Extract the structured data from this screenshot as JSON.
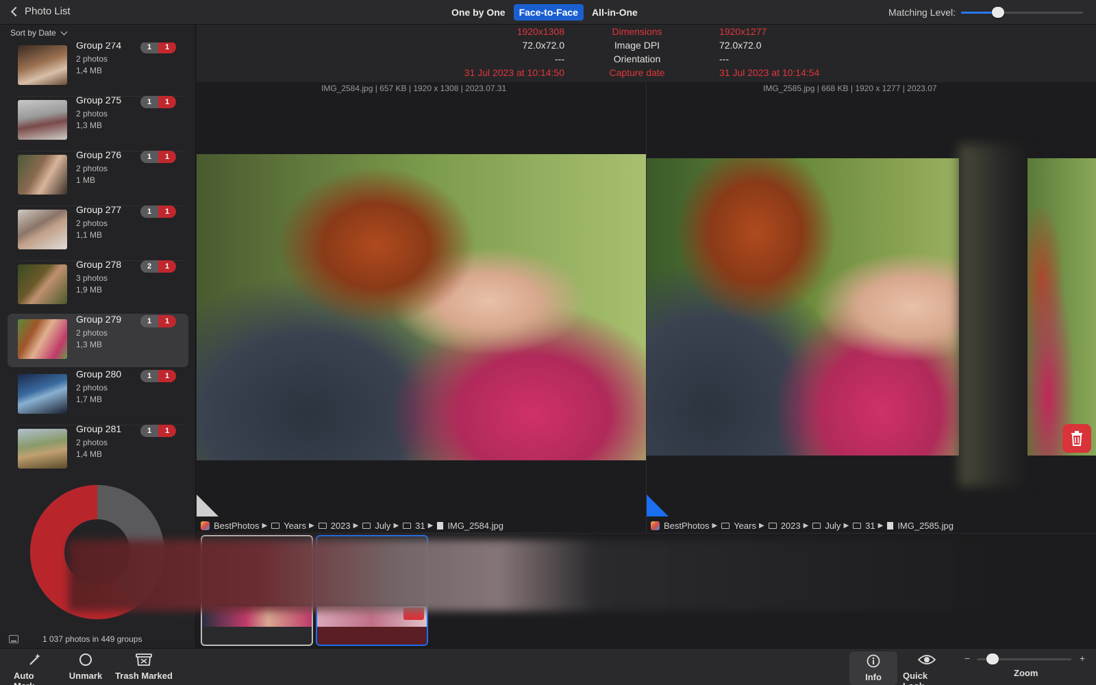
{
  "header": {
    "back_label": "Photo List",
    "modes": [
      {
        "label": "One by One",
        "active": false
      },
      {
        "label": "Face-to-Face",
        "active": true
      },
      {
        "label": "All-in-One",
        "active": false
      }
    ],
    "matching_label": "Matching Level:",
    "matching_level": 0.28
  },
  "sidebar": {
    "sort_label": "Sort by Date",
    "groups": [
      {
        "name": "Group 274",
        "photos": "2 photos",
        "size": "1,4 MB",
        "keep": "1",
        "marked": "1",
        "selected": false
      },
      {
        "name": "Group 275",
        "photos": "2 photos",
        "size": "1,3 MB",
        "keep": "1",
        "marked": "1",
        "selected": false
      },
      {
        "name": "Group 276",
        "photos": "2 photos",
        "size": "1 MB",
        "keep": "1",
        "marked": "1",
        "selected": false
      },
      {
        "name": "Group 277",
        "photos": "2 photos",
        "size": "1,1 MB",
        "keep": "1",
        "marked": "1",
        "selected": false
      },
      {
        "name": "Group 278",
        "photos": "3 photos",
        "size": "1,9 MB",
        "keep": "2",
        "marked": "1",
        "selected": false
      },
      {
        "name": "Group 279",
        "photos": "2 photos",
        "size": "1,3 MB",
        "keep": "1",
        "marked": "1",
        "selected": true
      },
      {
        "name": "Group 280",
        "photos": "2 photos",
        "size": "1,7 MB",
        "keep": "1",
        "marked": "1",
        "selected": false
      },
      {
        "name": "Group 281",
        "photos": "2 photos",
        "size": "1,4 MB",
        "keep": "1",
        "marked": "1",
        "selected": false
      }
    ],
    "summary": "1 037 photos in 449 groups",
    "donut_marked_fraction": 0.6
  },
  "info": {
    "rows": [
      {
        "left": "1920x1308",
        "label": "Dimensions",
        "right": "1920x1277",
        "highlight": true
      },
      {
        "left": "72.0x72.0",
        "label": "Image DPI",
        "right": "72.0x72.0",
        "highlight": false
      },
      {
        "left": "---",
        "label": "Orientation",
        "right": "---",
        "highlight": false
      },
      {
        "left": "31 Jul 2023 at 10:14:50",
        "label": "Capture date",
        "right": "31 Jul 2023 at 10:14:54",
        "highlight": true
      }
    ]
  },
  "panes": [
    {
      "fileinfo": "IMG_2584.jpg | 657 KB | 1920 x 1308 | 2023.07.31",
      "breadcrumb": [
        "BestPhotos",
        "Years",
        "2023",
        "July",
        "31",
        "IMG_2584.jpg"
      ]
    },
    {
      "fileinfo": "IMG_2585.jpg | 668 KB | 1920 x 1277 | 2023.07",
      "breadcrumb": [
        "BestPhotos",
        "Years",
        "2023",
        "July",
        "31",
        "IMG_2585.jpg"
      ]
    }
  ],
  "toolbar": {
    "auto_mark": "Auto Mark",
    "unmark": "Unmark",
    "trash_marked": "Trash Marked",
    "info": "Info",
    "quick_look": "Quick Look",
    "zoom": "Zoom",
    "zoom_minus": "−",
    "zoom_plus": "+",
    "zoom_level": 0.12
  },
  "colors": {
    "accent": "#1a5fd0",
    "marked_red": "#c0282e",
    "keep_gray": "#5a5a5d"
  }
}
